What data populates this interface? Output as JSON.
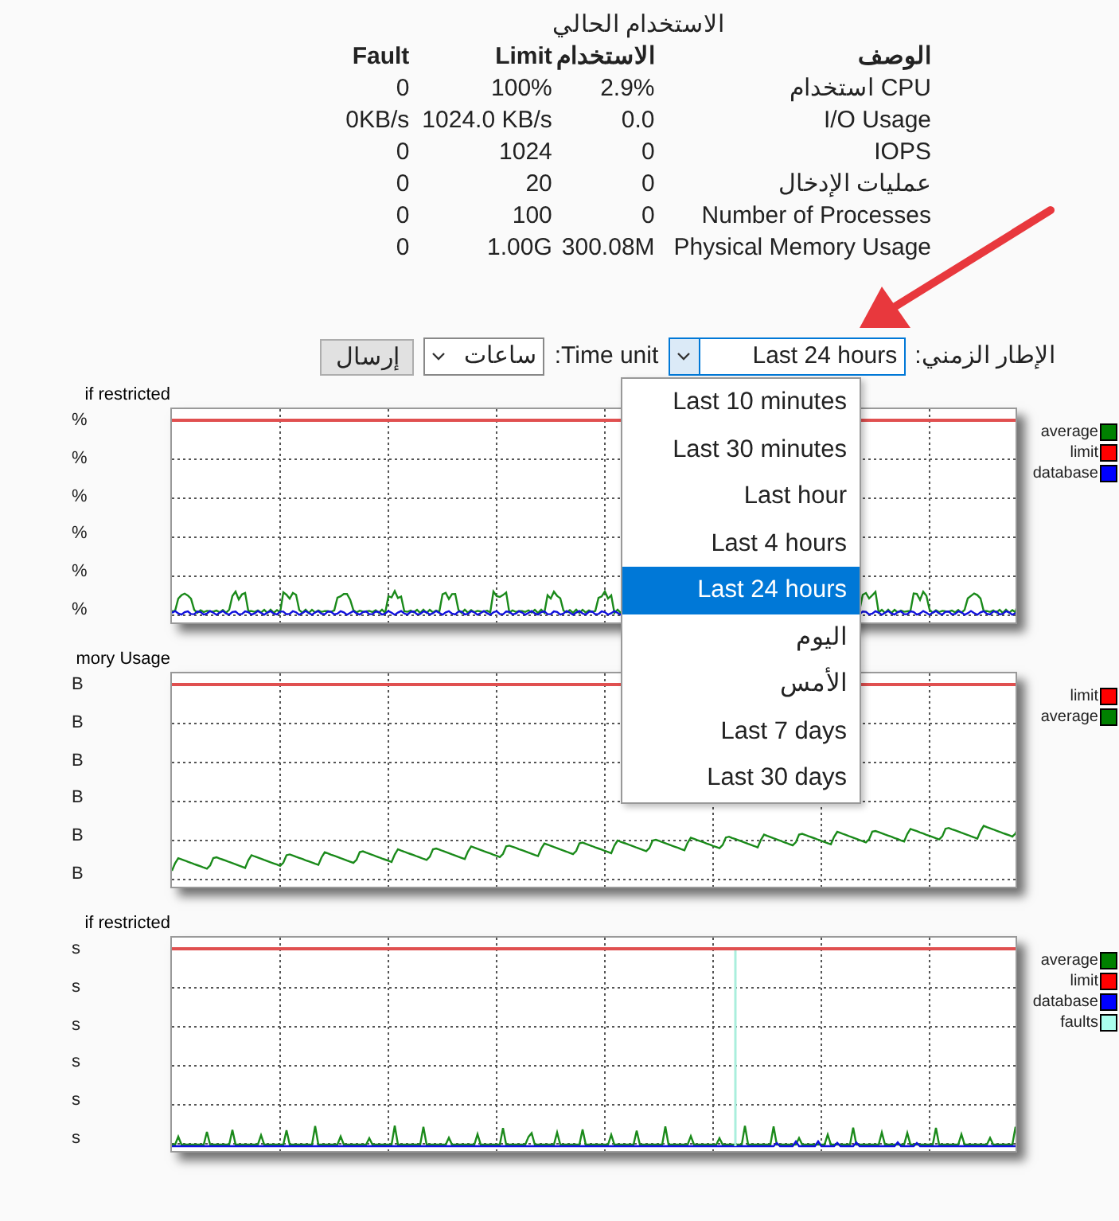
{
  "usage_table": {
    "caption": "الاستخدام الحالي",
    "columns": [
      "Fault",
      "Limit",
      "الاستخدام",
      "الوصف"
    ],
    "rows": [
      [
        "0",
        "100%",
        "2.9%",
        "استخدام CPU"
      ],
      [
        "0KB/s",
        "1024.0 KB/s",
        "0.0",
        "I/O Usage"
      ],
      [
        "0",
        "1024",
        "0",
        "IOPS"
      ],
      [
        "0",
        "20",
        "0",
        "عمليات الإدخال"
      ],
      [
        "0",
        "100",
        "0",
        "Number of Processes"
      ],
      [
        "0",
        "1.00G",
        "300.08M",
        "Physical Memory Usage"
      ]
    ]
  },
  "controls": {
    "time_frame": {
      "label": "الإطار الزمني:",
      "value": "Last 24 hours",
      "expanded": true,
      "options": [
        {
          "label": "Last 10 minutes",
          "selected": false
        },
        {
          "label": "Last 30 minutes",
          "selected": false
        },
        {
          "label": "Last hour",
          "selected": false
        },
        {
          "label": "Last 4 hours",
          "selected": false
        },
        {
          "label": "Last 24 hours",
          "selected": true
        },
        {
          "label": "اليوم",
          "selected": false
        },
        {
          "label": "الأمس",
          "selected": false
        },
        {
          "label": "Last 7 days",
          "selected": false
        },
        {
          "label": "Last 30 days",
          "selected": false
        }
      ]
    },
    "time_unit": {
      "label": "Time unit:",
      "value": "ساعات"
    },
    "submit": "إرسال"
  },
  "charts": [
    {
      "title": "if restricted",
      "axis_labels": [
        "%",
        "%",
        "%",
        "%",
        "%",
        "%"
      ],
      "legend": [
        {
          "name": "average",
          "color": "#008000"
        },
        {
          "name": "limit",
          "color": "#ff0000"
        },
        {
          "name": "database",
          "color": "#0000ff"
        }
      ]
    },
    {
      "title": "mory Usage",
      "axis_labels": [
        "B",
        "B",
        "B",
        "B",
        "B",
        "B"
      ],
      "legend": [
        {
          "name": "limit",
          "color": "#ff0000"
        },
        {
          "name": "average",
          "color": "#008000"
        }
      ]
    },
    {
      "title": "if restricted",
      "axis_labels": [
        "s",
        "s",
        "s",
        "s",
        "s",
        "s"
      ],
      "legend": [
        {
          "name": "average",
          "color": "#008000"
        },
        {
          "name": "limit",
          "color": "#ff0000"
        },
        {
          "name": "database",
          "color": "#0000ff"
        },
        {
          "name": "faults",
          "color": "#aaffee"
        }
      ]
    }
  ]
}
